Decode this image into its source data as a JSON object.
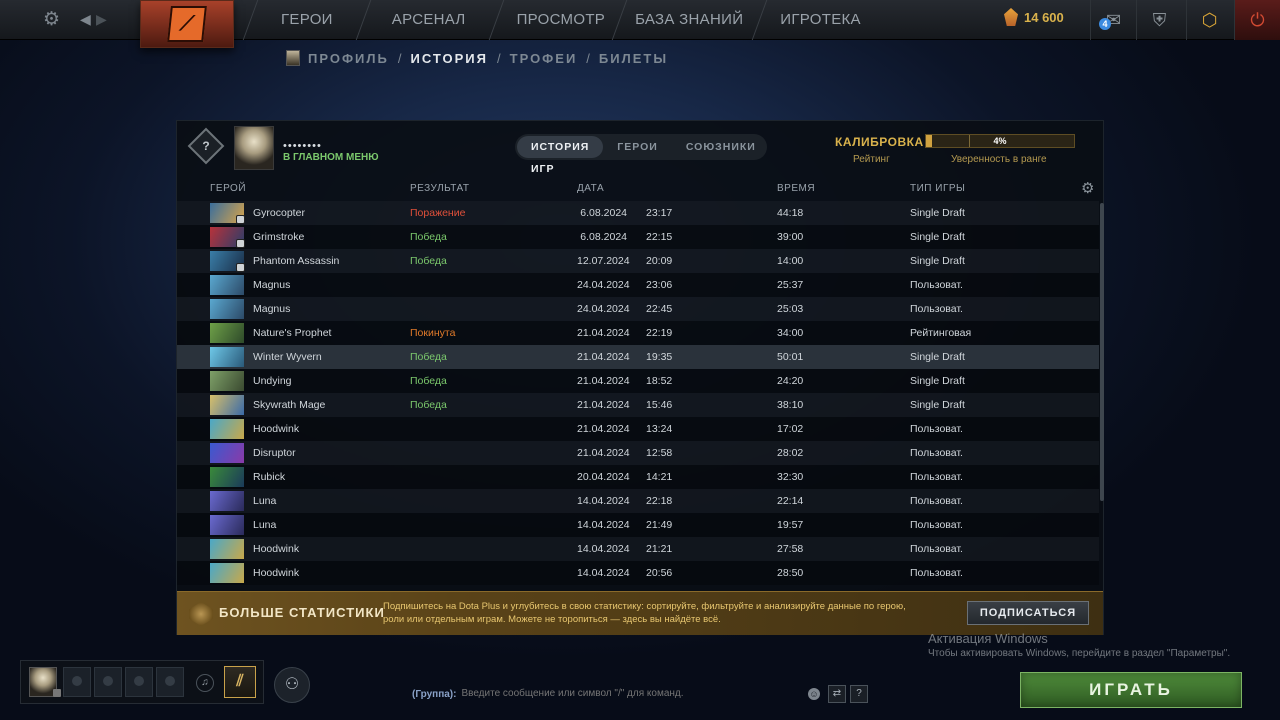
{
  "topbar": {
    "nav": [
      "ГЕРОИ",
      "АРСЕНАЛ",
      "ПРОСМОТР",
      "БАЗА ЗНАНИЙ",
      "ИГРОТЕКА"
    ],
    "shards": "14 600",
    "mail_badge": "4"
  },
  "subnav": {
    "items": [
      "ПРОФИЛЬ",
      "ИСТОРИЯ",
      "ТРОФЕИ",
      "БИЛЕТЫ"
    ],
    "separator": "/",
    "active": "ИСТОРИЯ"
  },
  "panel": {
    "rank_icon_text": "?",
    "player_name": "••••••••",
    "player_status": "В ГЛАВНОМ МЕНЮ",
    "tabs": [
      "ИСТОРИЯ ИГР",
      "ГЕРОИ",
      "СОЮЗНИКИ"
    ],
    "calibration": {
      "label": "КАЛИБРОВКА",
      "rating_label": "Рейтинг",
      "confidence_label": "Уверенность в ранге",
      "percent_text": "4%",
      "percent": 4
    },
    "columns": [
      "ГЕРОЙ",
      "РЕЗУЛЬТАТ",
      "ДАТА",
      "ВРЕМЯ",
      "ТИП ИГРЫ"
    ],
    "matches": [
      {
        "hero": "Gyrocopter",
        "result": "Поражение",
        "result_kind": "loss",
        "date": "6.08.2024",
        "time": "23:17",
        "duration": "44:18",
        "type": "Single Draft",
        "color1": "#3a6e9c",
        "color2": "#d8a44a"
      },
      {
        "hero": "Grimstroke",
        "result": "Победа",
        "result_kind": "win",
        "date": "6.08.2024",
        "time": "22:15",
        "duration": "39:00",
        "type": "Single Draft",
        "color1": "#b8323a",
        "color2": "#2a3d6a"
      },
      {
        "hero": "Phantom Assassin",
        "result": "Победа",
        "result_kind": "win",
        "date": "12.07.2024",
        "time": "20:09",
        "duration": "14:00",
        "type": "Single Draft",
        "color1": "#3a7ea8",
        "color2": "#1a2e48"
      },
      {
        "hero": "Magnus",
        "result": "",
        "result_kind": "none",
        "date": "24.04.2024",
        "time": "23:06",
        "duration": "25:37",
        "type": "Пользоват.",
        "color1": "#5aa8d0",
        "color2": "#2c4a68"
      },
      {
        "hero": "Magnus",
        "result": "",
        "result_kind": "none",
        "date": "24.04.2024",
        "time": "22:45",
        "duration": "25:03",
        "type": "Пользоват.",
        "color1": "#5aa8d0",
        "color2": "#2c4a68"
      },
      {
        "hero": "Nature's Prophet",
        "result": "Покинута",
        "result_kind": "left",
        "date": "21.04.2024",
        "time": "22:19",
        "duration": "34:00",
        "type": "Рейтинговая",
        "color1": "#6ea048",
        "color2": "#2e4a2a"
      },
      {
        "hero": "Winter Wyvern",
        "result": "Победа",
        "result_kind": "win",
        "date": "21.04.2024",
        "time": "19:35",
        "duration": "50:01",
        "type": "Single Draft",
        "color1": "#6ec8e8",
        "color2": "#2a5a7a"
      },
      {
        "hero": "Undying",
        "result": "Победа",
        "result_kind": "win",
        "date": "21.04.2024",
        "time": "18:52",
        "duration": "24:20",
        "type": "Single Draft",
        "color1": "#7ea068",
        "color2": "#3a4a30"
      },
      {
        "hero": "Skywrath Mage",
        "result": "Победа",
        "result_kind": "win",
        "date": "21.04.2024",
        "time": "15:46",
        "duration": "38:10",
        "type": "Single Draft",
        "color1": "#d8c06a",
        "color2": "#3a6aa8"
      },
      {
        "hero": "Hoodwink",
        "result": "",
        "result_kind": "none",
        "date": "21.04.2024",
        "time": "13:24",
        "duration": "17:02",
        "type": "Пользоват.",
        "color1": "#4aa8c8",
        "color2": "#c8a84a"
      },
      {
        "hero": "Disruptor",
        "result": "",
        "result_kind": "none",
        "date": "21.04.2024",
        "time": "12:58",
        "duration": "28:02",
        "type": "Пользоват.",
        "color1": "#3a5ad0",
        "color2": "#8a3aa8"
      },
      {
        "hero": "Rubick",
        "result": "",
        "result_kind": "none",
        "date": "20.04.2024",
        "time": "14:21",
        "duration": "32:30",
        "type": "Пользоват.",
        "color1": "#3a8a3a",
        "color2": "#1a3a5a"
      },
      {
        "hero": "Luna",
        "result": "",
        "result_kind": "none",
        "date": "14.04.2024",
        "time": "22:18",
        "duration": "22:14",
        "type": "Пользоват.",
        "color1": "#6a6ad0",
        "color2": "#2a2a5a"
      },
      {
        "hero": "Luna",
        "result": "",
        "result_kind": "none",
        "date": "14.04.2024",
        "time": "21:49",
        "duration": "19:57",
        "type": "Пользоват.",
        "color1": "#6a6ad0",
        "color2": "#2a2a5a"
      },
      {
        "hero": "Hoodwink",
        "result": "",
        "result_kind": "none",
        "date": "14.04.2024",
        "time": "21:21",
        "duration": "27:58",
        "type": "Пользоват.",
        "color1": "#4aa8c8",
        "color2": "#c8a84a"
      },
      {
        "hero": "Hoodwink",
        "result": "",
        "result_kind": "none",
        "date": "14.04.2024",
        "time": "20:56",
        "duration": "28:50",
        "type": "Пользоват.",
        "color1": "#4aa8c8",
        "color2": "#c8a84a"
      }
    ],
    "promo": {
      "title": "БОЛЬШЕ СТАТИСТИКИ",
      "text": "Подпишитесь на Dota Plus и углубитесь в свою статистику: сортируйте, фильтруйте и анализируйте данные по герою, роли или отдельным играм. Можете не торопиться — здесь вы найдёте всё.",
      "button": "ПОДПИСАТЬСЯ"
    }
  },
  "watermark": {
    "title": "Активация Windows",
    "subtitle": "Чтобы активировать Windows, перейдите в раздел \"Параметры\"."
  },
  "bottom": {
    "chat_label": "(Группа):",
    "chat_placeholder": "Введите сообщение или символ \"/\" для команд.",
    "help": "?",
    "play": "ИГРАТЬ"
  },
  "colors": {
    "win": "#7bc86c",
    "loss": "#e0503a",
    "left": "#e07a2a",
    "gold": "#d9b24c",
    "play": "#4f8c3b"
  }
}
